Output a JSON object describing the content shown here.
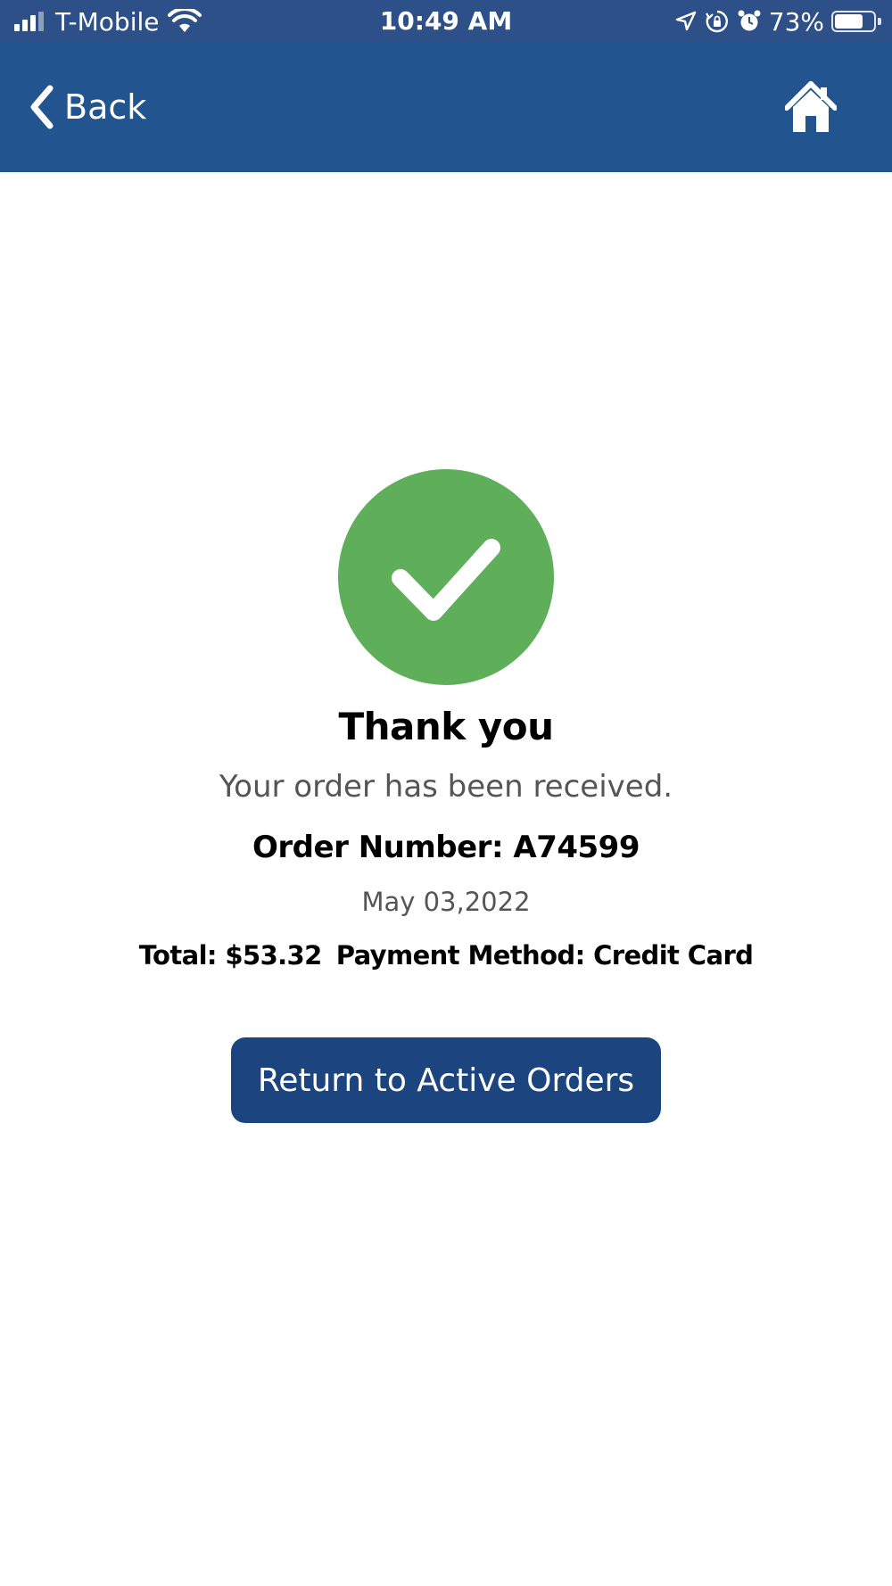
{
  "status_bar": {
    "carrier": "T-Mobile",
    "time": "10:49 AM",
    "battery_percent": "73%",
    "battery_level": 0.73,
    "signal_bars": 3,
    "icons": [
      "signal-icon",
      "wifi-icon",
      "location-icon",
      "rotation-lock-icon",
      "alarm-icon",
      "battery-icon"
    ]
  },
  "nav": {
    "back_label": "Back",
    "back_icon": "chevron-left-icon",
    "home_icon": "home-icon"
  },
  "confirmation": {
    "icon": "checkmark-icon",
    "icon_color": "#5fae5a",
    "title": "Thank you",
    "message": "Your order has been received.",
    "order_number": "Order Number: A74599",
    "date": "May 03,2022",
    "total": "Total: $53.32",
    "payment_method": "Payment Method: Credit Card"
  },
  "actions": {
    "return_label": "Return to Active Orders"
  },
  "colors": {
    "status_bar": "#2d5088",
    "nav_bar": "#225590",
    "button": "#1c4580",
    "success": "#5fae5a"
  }
}
